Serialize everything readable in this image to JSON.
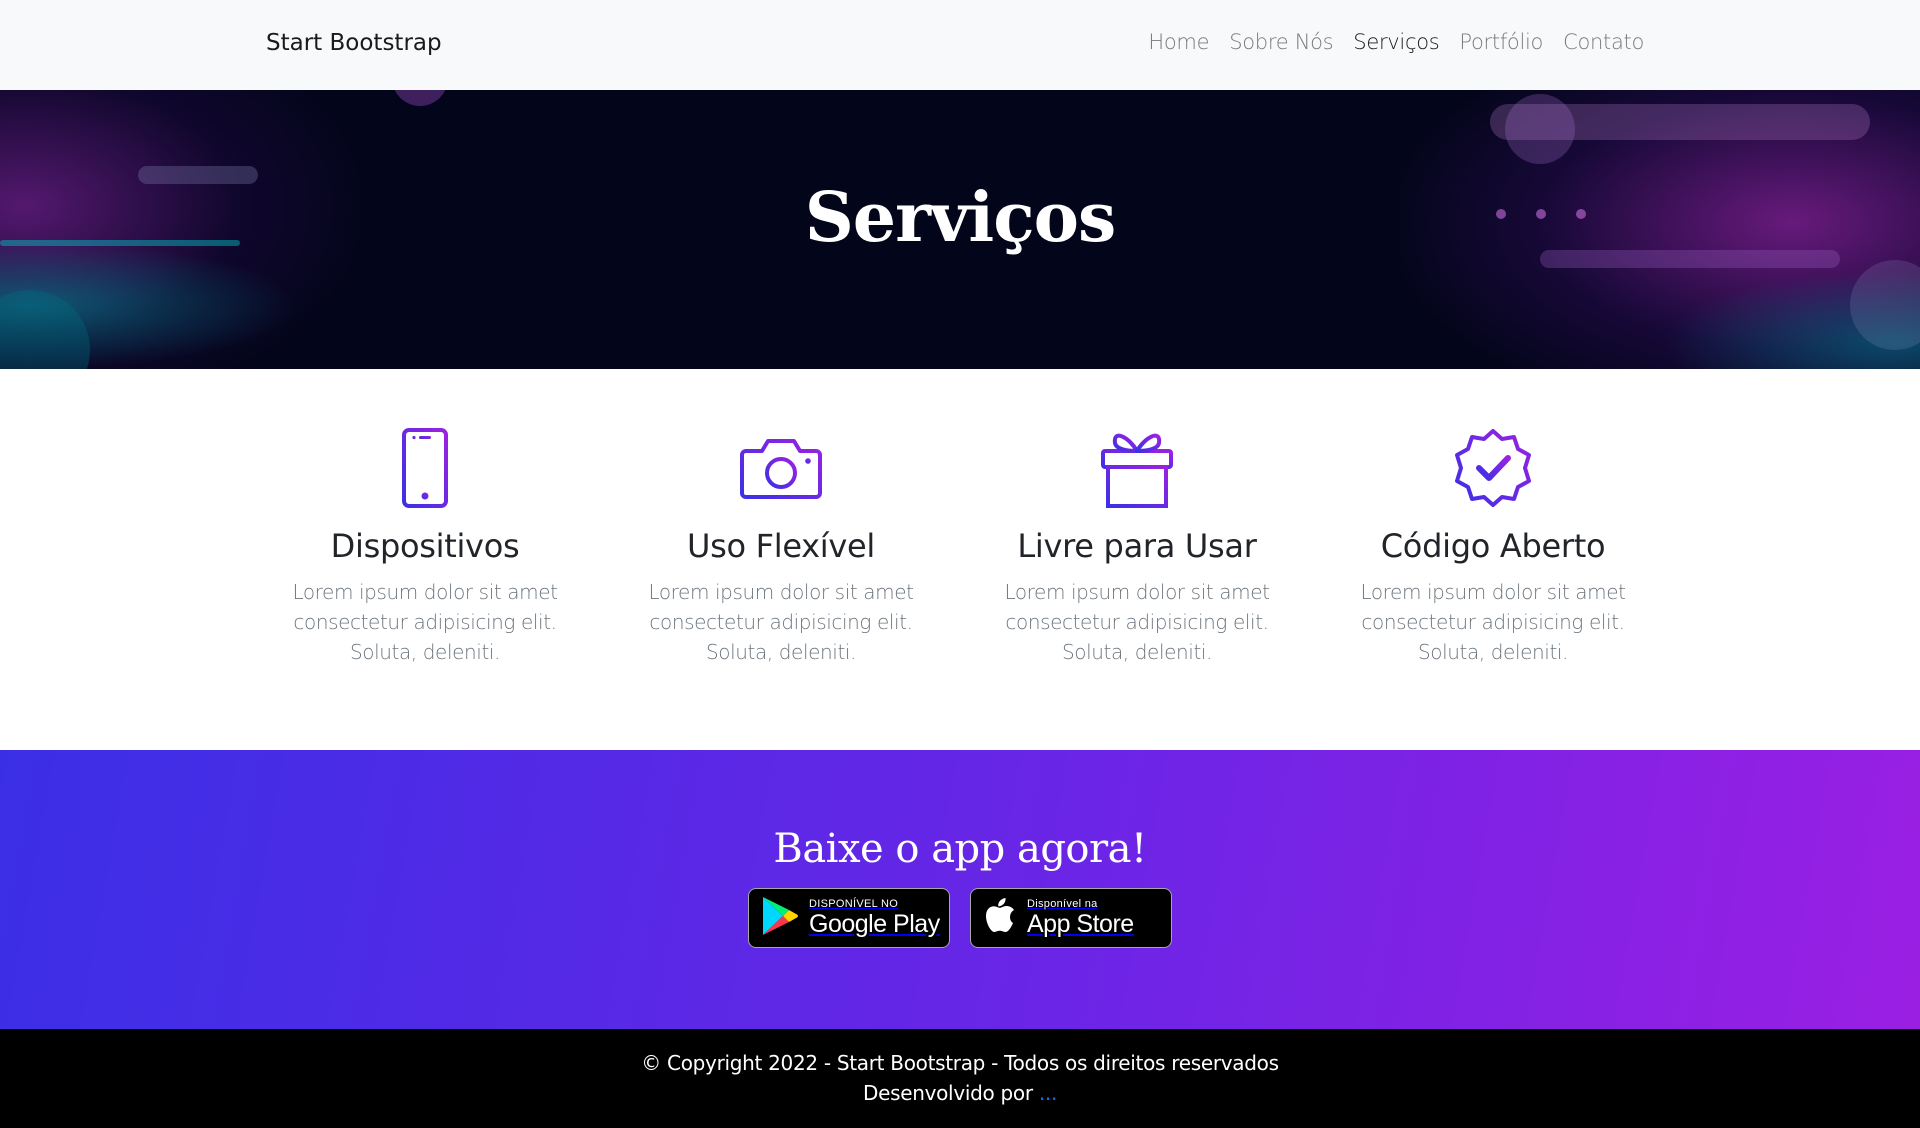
{
  "navbar": {
    "brand": "Start Bootstrap",
    "items": [
      {
        "label": "Home"
      },
      {
        "label": "Sobre Nós"
      },
      {
        "label": "Serviços",
        "active": true
      },
      {
        "label": "Portfólio"
      },
      {
        "label": "Contato"
      }
    ]
  },
  "hero": {
    "title": "Serviços"
  },
  "services": [
    {
      "icon": "smartphone-icon",
      "title": "Dispositivos",
      "text": "Lorem ipsum dolor sit amet consectetur adipisicing elit. Soluta, deleniti."
    },
    {
      "icon": "camera-icon",
      "title": "Uso Flexível",
      "text": "Lorem ipsum dolor sit amet consectetur adipisicing elit. Soluta, deleniti."
    },
    {
      "icon": "gift-icon",
      "title": "Livre para Usar",
      "text": "Lorem ipsum dolor sit amet consectetur adipisicing elit. Soluta, deleniti."
    },
    {
      "icon": "verified-badge-icon",
      "title": "Código Aberto",
      "text": "Lorem ipsum dolor sit amet consectetur adipisicing elit. Soluta, deleniti."
    }
  ],
  "download": {
    "title": "Baixe o app agora!",
    "google_play": {
      "small": "DISPONÍVEL NO",
      "big": "Google Play"
    },
    "app_store": {
      "small": "Disponível na",
      "big": "App Store"
    }
  },
  "footer": {
    "copyright": "© Copyright 2022 - Start Bootstrap - Todos os direitos reservados",
    "developed_by": "Desenvolvido por",
    "developer_link": "..."
  },
  "colors": {
    "icon_gradient_start": "#3b30e6",
    "icon_gradient_end": "#9b22e0",
    "band_gradient_start": "#3b2fe6",
    "band_gradient_end": "#9a1fe3",
    "footer_link": "#0d6efd"
  }
}
